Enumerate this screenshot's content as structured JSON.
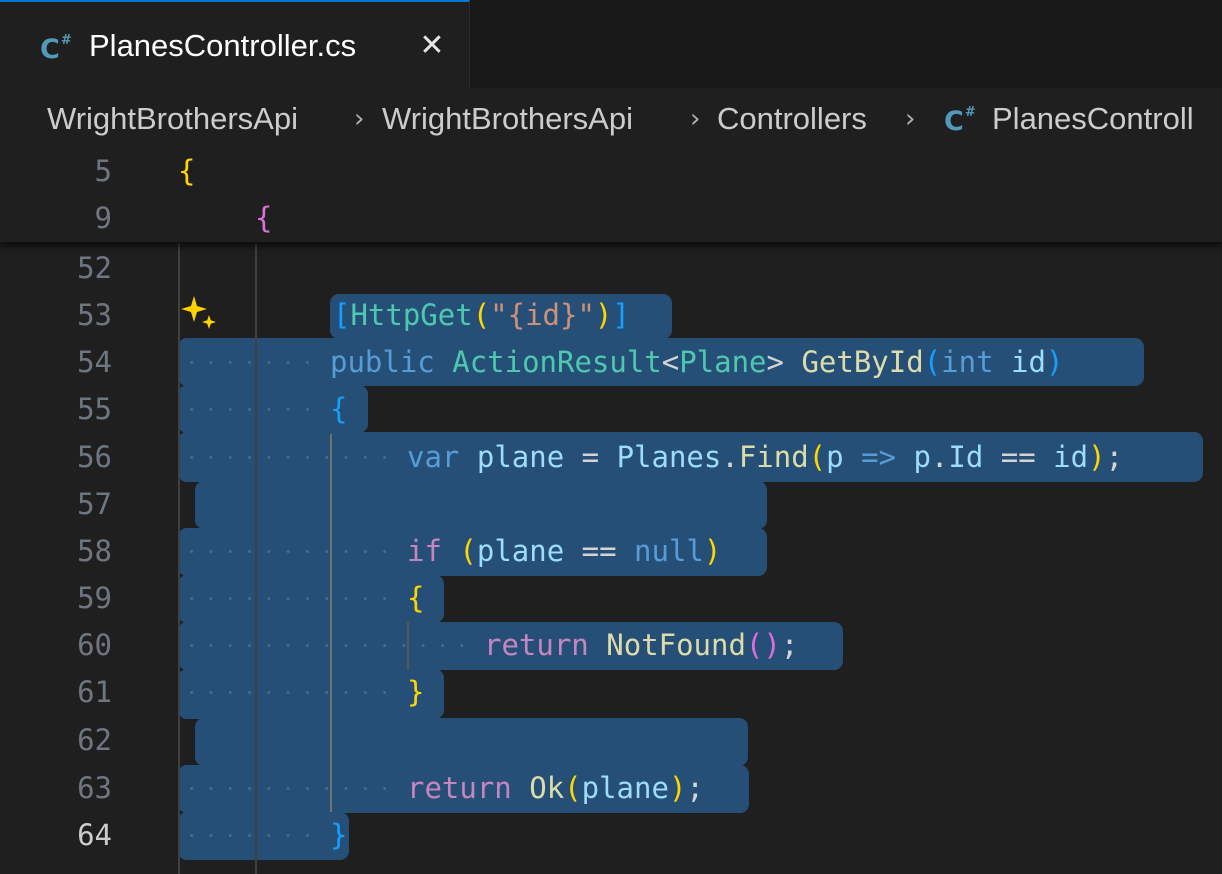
{
  "tab": {
    "icon": "csharp-file-icon",
    "icon_text": "C",
    "icon_sup": "#",
    "label": "PlanesController.cs",
    "close": "✕"
  },
  "breadcrumb": {
    "items": [
      "WrightBrothersApi",
      "WrightBrothersApi",
      "Controllers",
      "PlanesControll"
    ],
    "separator": "›",
    "file_icon": "csharp-file-icon"
  },
  "sticky_lines": [
    {
      "number": "5",
      "code": "{"
    },
    {
      "number": "9",
      "code": "{"
    }
  ],
  "line_numbers": [
    "52",
    "53",
    "54",
    "55",
    "56",
    "57",
    "58",
    "59",
    "60",
    "61",
    "62",
    "63",
    "64"
  ],
  "current_line": "64",
  "code": {
    "l53": {
      "open": "[",
      "attr": "HttpGet",
      "lp": "(",
      "str": "\"{id}\"",
      "rp": ")",
      "close": "]"
    },
    "l54": {
      "mod": "public",
      "type": "ActionResult",
      "lt": "<",
      "generic": "Plane",
      "gt": ">",
      "method": "GetById",
      "lp": "(",
      "ptype": "int",
      "pname": "id",
      "rp": ")"
    },
    "l55": {
      "brace": "{"
    },
    "l56": {
      "var": "var",
      "name": "plane",
      "eq": "=",
      "coll": "Planes",
      "dot": ".",
      "fn": "Find",
      "lp": "(",
      "p": "p",
      "arrow": "=>",
      "p2": "p",
      "dot2": ".",
      "prop": "Id",
      "eqeq": "==",
      "id": "id",
      "rp": ")",
      "semi": ";"
    },
    "l58": {
      "kw": "if",
      "lp": "(",
      "name": "plane",
      "eqeq": "==",
      "nul": "null",
      "rp": ")"
    },
    "l59": {
      "brace": "{"
    },
    "l60": {
      "kw": "return",
      "fn": "NotFound",
      "lp": "(",
      "rp": ")",
      "semi": ";"
    },
    "l61": {
      "brace": "}"
    },
    "l63": {
      "kw": "return",
      "fn": "Ok",
      "lp": "(",
      "name": "plane",
      "rp": ")",
      "semi": ";"
    },
    "l64": {
      "brace": "}"
    }
  },
  "icons": {
    "gutter_action": "sparkle-icon"
  },
  "colors": {
    "selection": "#264f78",
    "bracket_level1": "#ffd700",
    "bracket_level2": "#da70d6",
    "bracket_level3": "#179fff",
    "keyword": "#569cd6",
    "control_keyword": "#c586c0",
    "type": "#4ec9b0",
    "function": "#dcdcaa",
    "variable": "#9cdcfe",
    "string": "#ce9178"
  }
}
